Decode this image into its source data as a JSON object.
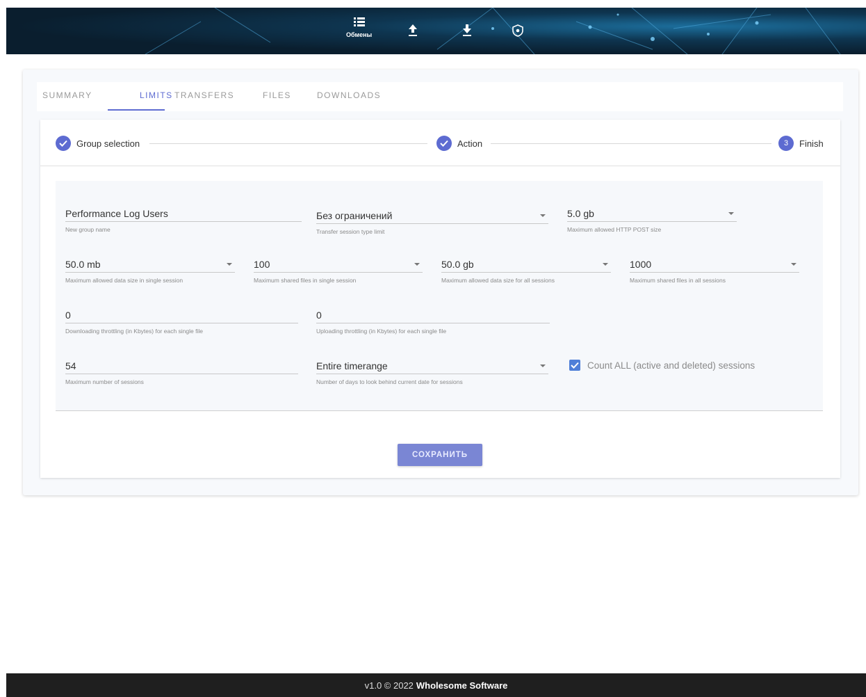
{
  "topnav": {
    "items": [
      {
        "icon": "list-icon",
        "label": "Обмены"
      },
      {
        "icon": "upload-icon",
        "label": ""
      },
      {
        "icon": "download-icon",
        "label": ""
      },
      {
        "icon": "shield-icon",
        "label": ""
      }
    ]
  },
  "tabs": [
    "SUMMARY",
    "LIMITS",
    "TRANSFERS",
    "FILES",
    "DOWNLOADS"
  ],
  "active_tab": "LIMITS",
  "stepper": {
    "steps": [
      {
        "label": "Group selection",
        "state": "done"
      },
      {
        "label": "Action",
        "state": "done"
      },
      {
        "label": "Finish",
        "state": "current",
        "number": "3"
      }
    ]
  },
  "form": {
    "group_name": {
      "value": "Performance Log Users",
      "hint": "New group name"
    },
    "transfer_session_type": {
      "value": "Без ограничений",
      "hint": "Transfer session type limit"
    },
    "max_http_post": {
      "value": "5.0 gb",
      "hint": "Maximum allowed HTTP POST size"
    },
    "max_data_single": {
      "value": "50.0 mb",
      "hint": "Maximum allowed data size in single session"
    },
    "max_files_single": {
      "value": "100",
      "hint": "Maximum shared files in single session"
    },
    "max_data_all": {
      "value": "50.0 gb",
      "hint": "Maximum allowed data size for all sessions"
    },
    "max_files_all": {
      "value": "1000",
      "hint": "Maximum shared files in all sessions"
    },
    "download_throttle": {
      "value": "0",
      "hint": "Downloading throttling (in Kbytes) for each single file"
    },
    "upload_throttle": {
      "value": "0",
      "hint": "Uploading throttling (in Kbytes) for each single file"
    },
    "max_sessions": {
      "value": "54",
      "hint": "Maximum number of sessions"
    },
    "days_behind": {
      "value": "Entire timerange",
      "hint": "Number of days to look behind current date for sessions"
    },
    "count_all": {
      "label": "Count ALL (active and deleted) sessions",
      "checked": true
    }
  },
  "save_label": "СОХРАНИТЬ",
  "footer": {
    "version": "v1.0 © 2022",
    "company": "Wholesome Software"
  },
  "colors": {
    "accent": "#5d6bd1",
    "button": "#7a86d4",
    "footer": "#1f1f1f"
  }
}
